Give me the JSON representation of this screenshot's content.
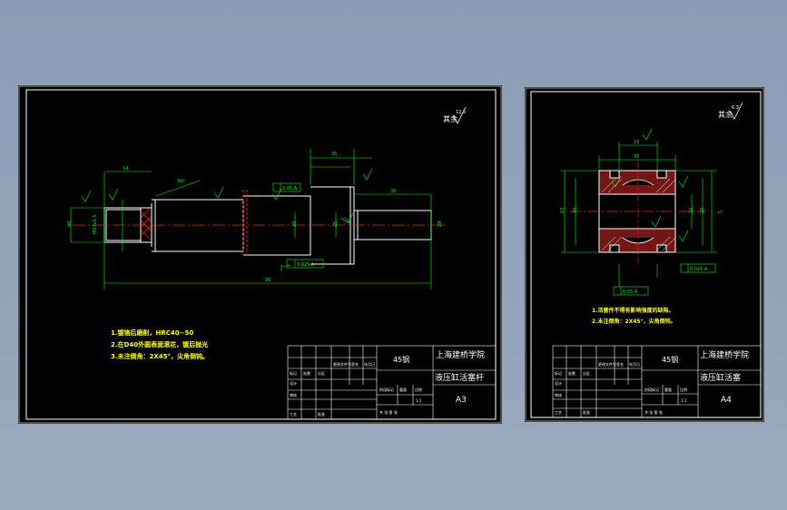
{
  "left_sheet": {
    "roughness_prefix": "其余",
    "roughness_value": "12.5",
    "dims": {
      "overall_length": "90",
      "length_a": "35",
      "length_b": "32",
      "length_c": "14",
      "dia_left": "40",
      "dia_left_inner": "M27x1.5",
      "dia_right": "20",
      "dia_mid": "25",
      "dia_end": "28",
      "angle": "30°"
    },
    "tolerances": {
      "upper": "0.05 A",
      "lower": "0.025 A"
    },
    "notes": [
      "1.镀铬后磨削，HRC40~50",
      "2.在D40外圆表面滚花，镀后抛光",
      "3.未注倒角：2X45°，尖角倒钝。"
    ],
    "title_block": {
      "material": "45钢",
      "school": "上海建桥学院",
      "part_name": "液压缸活塞杆",
      "sheet_size": "A3",
      "row_labels": [
        "标记",
        "处数",
        "分区",
        "更改文件号",
        "签名",
        "年月日"
      ],
      "role_labels": [
        "设计",
        "审核",
        "工艺",
        "批准"
      ],
      "stage_label": "阶段标记",
      "weight_label": "重量",
      "scale_label": "比例",
      "scale_value": "1:1",
      "sheet_info": "共  张  第  张"
    }
  },
  "right_sheet": {
    "roughness_prefix": "其余",
    "roughness_value": "6.3",
    "dims": {
      "outer_dia": "63",
      "inner_dia": "40",
      "bore": "20",
      "groove": "25",
      "width": "35",
      "groove_w": "10",
      "groove_depth": "5"
    },
    "tolerances": {
      "upper": "0.025 A",
      "lower": "0.05 A"
    },
    "notes": [
      "1.活塞件不得有影响强度的缺陷。",
      "2.未注倒角：2X45°，尖角倒钝。"
    ],
    "title_block": {
      "material": "45钢",
      "school": "上海建桥学院",
      "part_name": "液压缸活塞",
      "sheet_size": "A4",
      "row_labels": [
        "标记",
        "处数",
        "分区",
        "更改文件号",
        "签名",
        "年月日"
      ],
      "role_labels": [
        "设计",
        "审核",
        "工艺",
        "批准"
      ],
      "stage_label": "阶段标记",
      "weight_label": "重量",
      "scale_label": "比例",
      "scale_value": "1:1",
      "sheet_info": "共  张  第  张"
    }
  },
  "colors": {
    "background": "#000000",
    "frame": "#ffffff",
    "outline": "#ffffff",
    "dimension": "#00ff00",
    "centerline": "#ff2020",
    "note_text": "#ffff00"
  }
}
